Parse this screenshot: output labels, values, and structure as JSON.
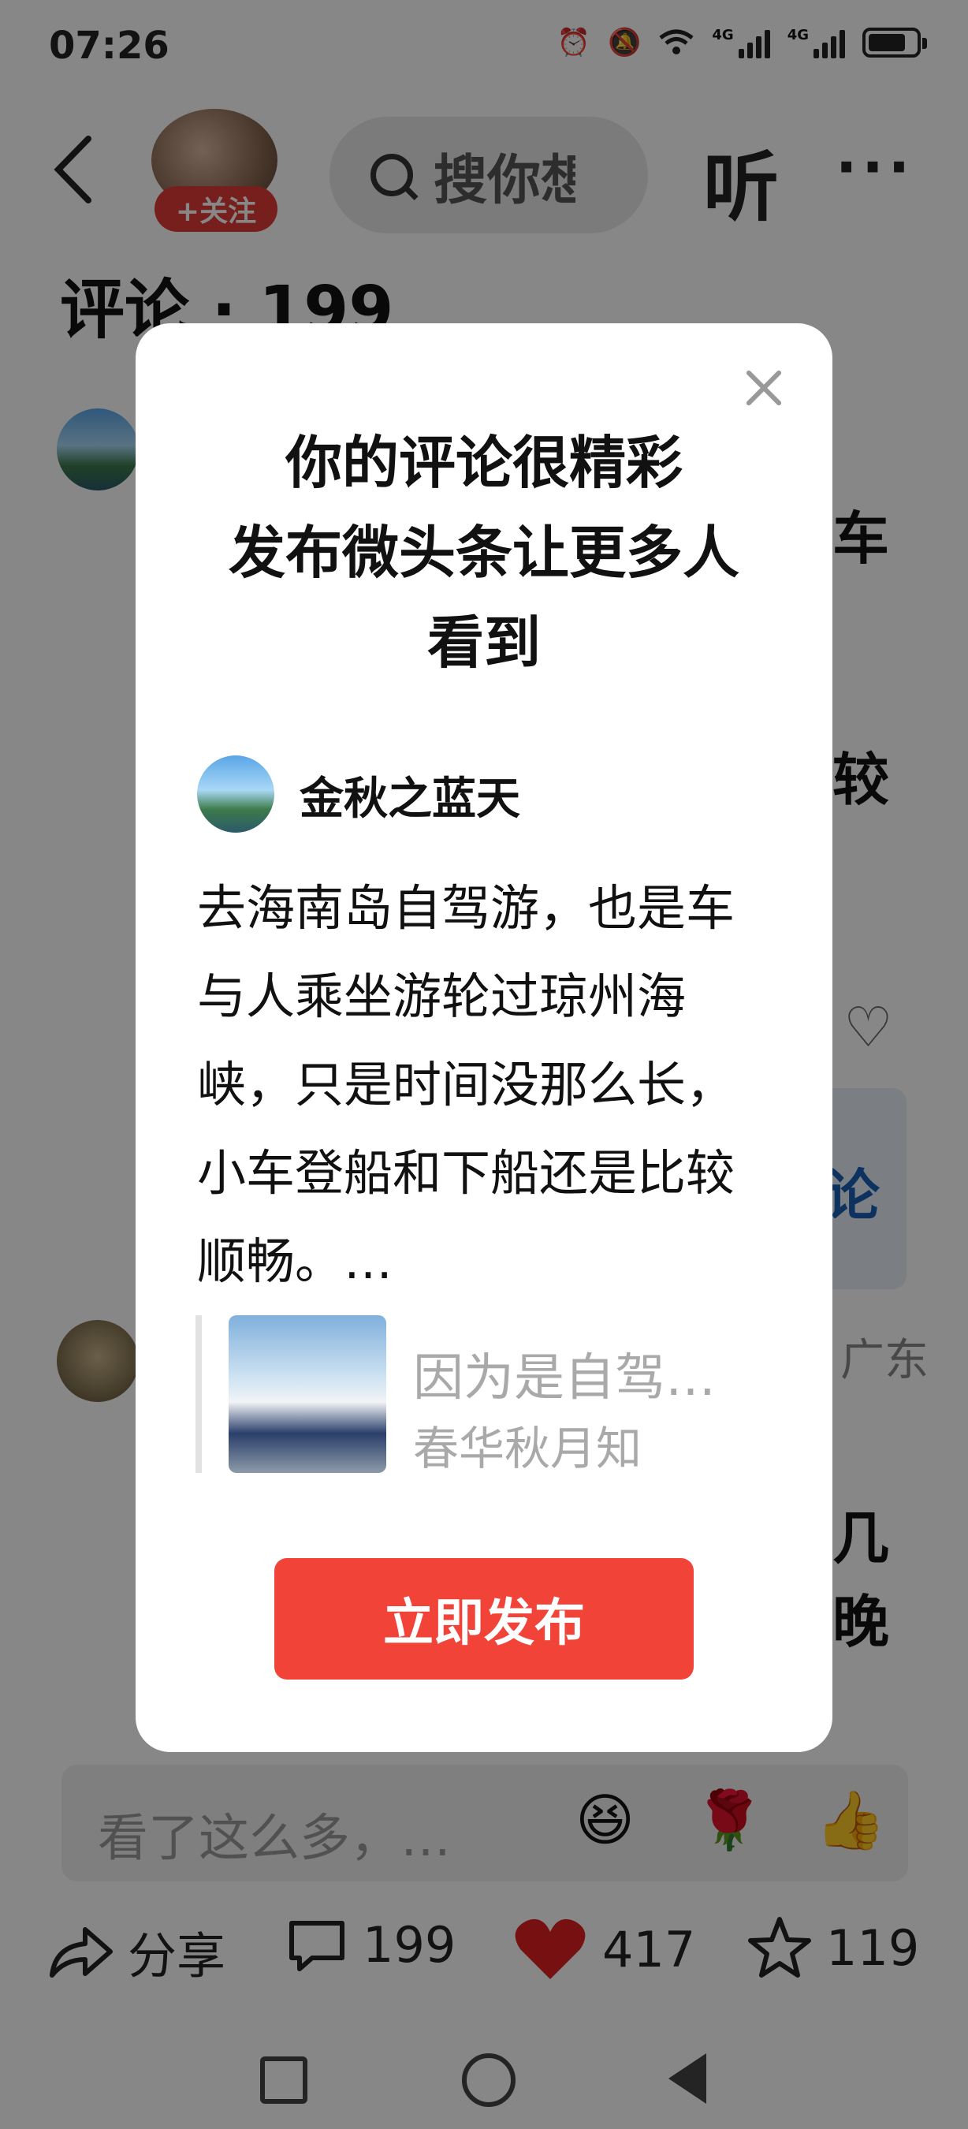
{
  "status_bar": {
    "time": "07:26",
    "net1": "4G",
    "net2": "4G"
  },
  "header": {
    "follow_label": "+关注",
    "search_text": "搜你想",
    "listen_label": "听",
    "more_label": "···"
  },
  "comments": {
    "title": "评论 · 199"
  },
  "background_fragments": {
    "f1": "车",
    "f2": "较",
    "f3": "论",
    "f4": "广东",
    "f5": "几",
    "f6": "晚"
  },
  "modal": {
    "title_line1": "你的评论很精彩",
    "title_line2": "发布微头条让更多人",
    "title_line3": "看到",
    "user_name": "金秋之蓝天",
    "comment_text": "去海南岛自驾游，也是车与人乘坐游轮过琼州海峡，只是时间没那么长，小车登船和下船还是比较顺畅。…",
    "quote_title": "因为是自驾…",
    "quote_author": "春华秋月知",
    "publish_label": "立即发布"
  },
  "bottom_bar": {
    "input_placeholder": "看了这么多，…",
    "emojis": [
      "😆",
      "🌹",
      "👍"
    ]
  },
  "actions": {
    "share_label": "分享",
    "comment_count": "199",
    "like_count": "417",
    "fav_count": "119"
  },
  "battery_level": 0.8
}
